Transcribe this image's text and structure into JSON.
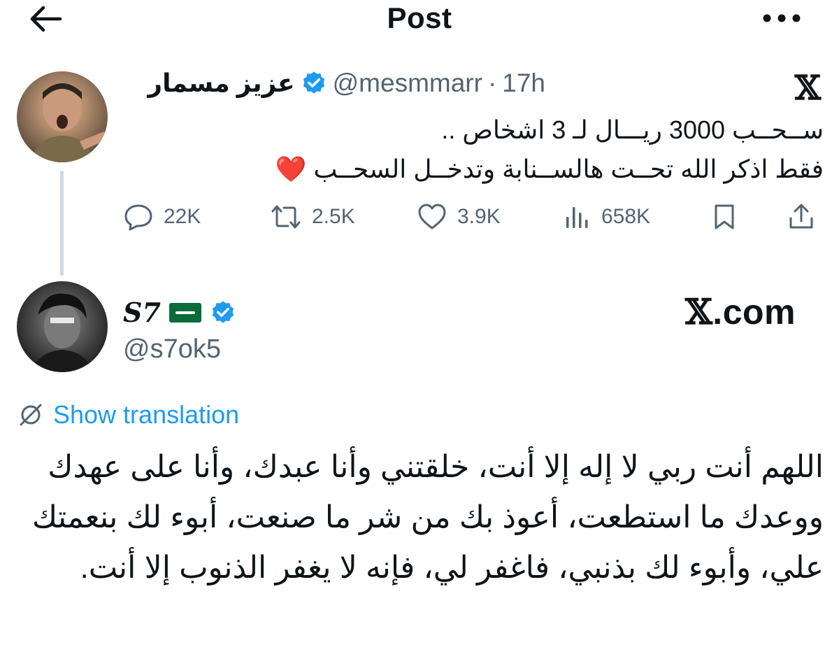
{
  "header": {
    "title": "Post"
  },
  "quoted_tweet": {
    "display_name": "عزيز مسمار",
    "handle": "@mesmmarr",
    "separator": "·",
    "time": "17h",
    "brand": "𝕏",
    "body_line_1": "ســحــب 3000 ريـــال لـ 3 اشخاص ..",
    "body_line_2": "فقط اذكر الله تحــت هالســنابة وتدخــل السحــب ❤️",
    "actions": {
      "replies": "22K",
      "reposts": "2.5K",
      "likes": "3.9K",
      "views": "658K"
    }
  },
  "post": {
    "display_name": "S7",
    "handle": "@s7ok5",
    "brand_x": "𝕏",
    "brand_domain": ".com",
    "show_translation": "Show translation",
    "body": "اللهم أنت ربي لا إله إلا أنت، خلقتني وأنا عبدك، وأنا على عهدك ووعدك ما استطعت، أعوذ بك من شر ما صنعت، أبوء لك بنعمتك علي، وأبوء لك بذنبي، فاغفر لي، فإنه لا يغفر الذنوب إلا أنت."
  },
  "colors": {
    "accent": "#1d9bf0",
    "secondary_text": "#536471",
    "verified": "#1d9bf0"
  }
}
